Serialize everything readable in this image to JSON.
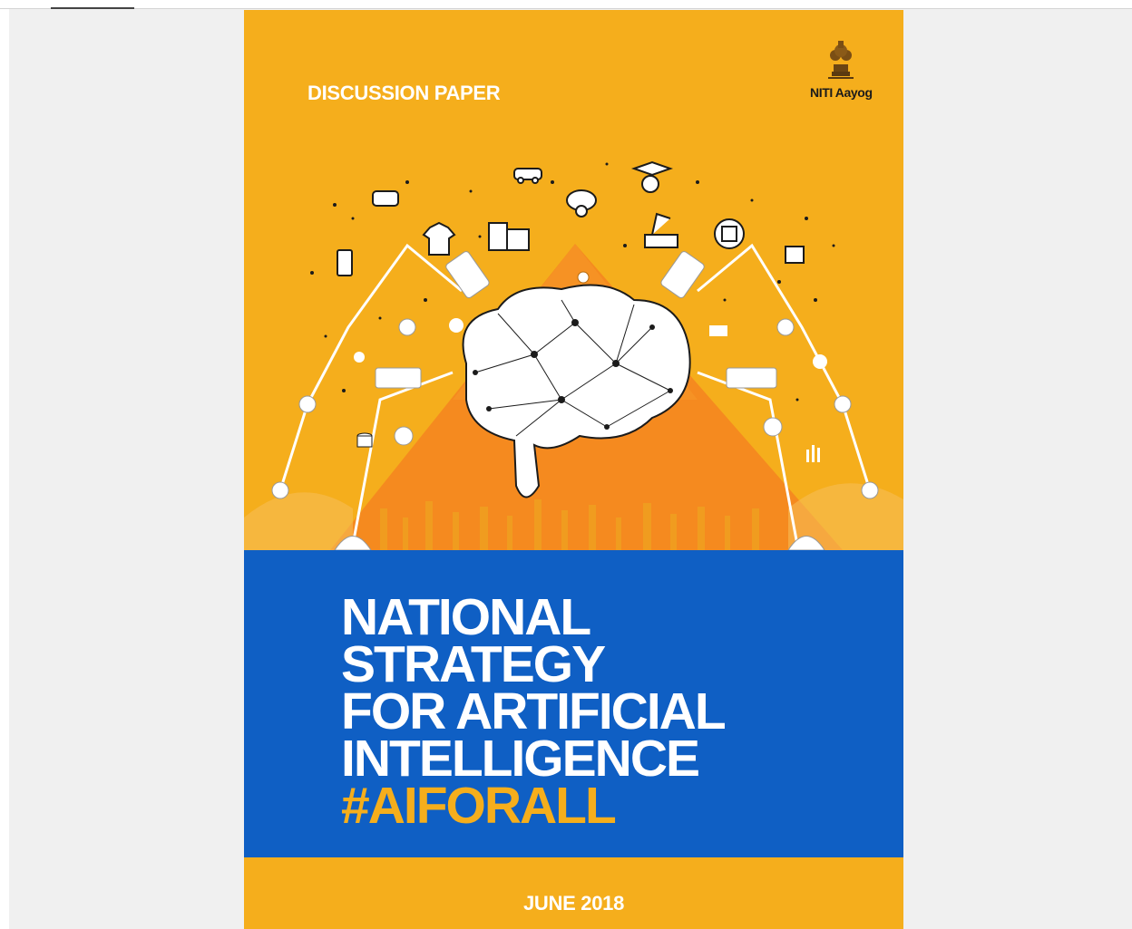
{
  "cover": {
    "kicker": "DISCUSSION PAPER",
    "publisher": "NITI Aayog",
    "title_lines": [
      "NATIONAL",
      "STRATEGY",
      "FOR ARTIFICIAL",
      "INTELLIGENCE"
    ],
    "hashtag": "#AIFORALL",
    "date": "JUNE 2018"
  },
  "colors": {
    "cover_orange": "#f5ae1c",
    "triangle_orange": "#f58a1f",
    "band_blue": "#0f5fc4",
    "title_white": "#ffffff",
    "hashtag_orange": "#f5ae1c"
  },
  "icons": [
    "national-emblem-icon",
    "brain-network-icon",
    "robot-arm-icon",
    "vr-glasses-icon",
    "self-driving-car-icon",
    "graduation-cap-icon",
    "cloud-globe-icon",
    "shirt-icon",
    "smart-city-icon",
    "apple-chip-icon",
    "phone-health-icon",
    "lightbulb-icon"
  ]
}
